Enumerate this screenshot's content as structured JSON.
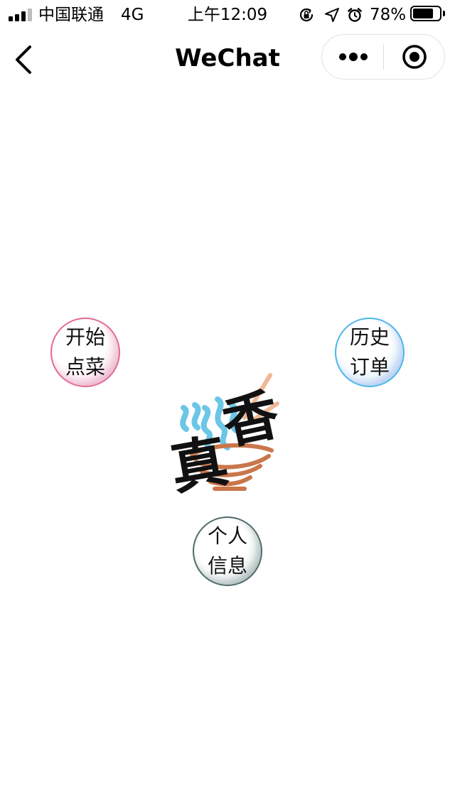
{
  "status_bar": {
    "carrier": "中国联通",
    "network": "4G",
    "time": "上午12:09",
    "battery_percent_text": "78%",
    "battery_level": 0.78,
    "icons": [
      "signal-icon",
      "orientation-lock-icon",
      "location-icon",
      "alarm-icon",
      "battery-icon"
    ]
  },
  "nav": {
    "title": "WeChat",
    "back_icon": "chevron-left-icon",
    "more_icon": "more-dots-icon",
    "close_icon": "target-icon"
  },
  "menu": {
    "order": "开始点菜",
    "history": "历史订单",
    "profile": "个人信息"
  },
  "logo": {
    "icon": "bowl-logo-icon",
    "text": "真香"
  },
  "colors": {
    "order_accent": "#e36a95",
    "history_accent": "#4bb6ea",
    "profile_accent": "#4f6b6a",
    "logo_bowl": "#c9774a",
    "logo_steam": "#6cc6e6"
  }
}
